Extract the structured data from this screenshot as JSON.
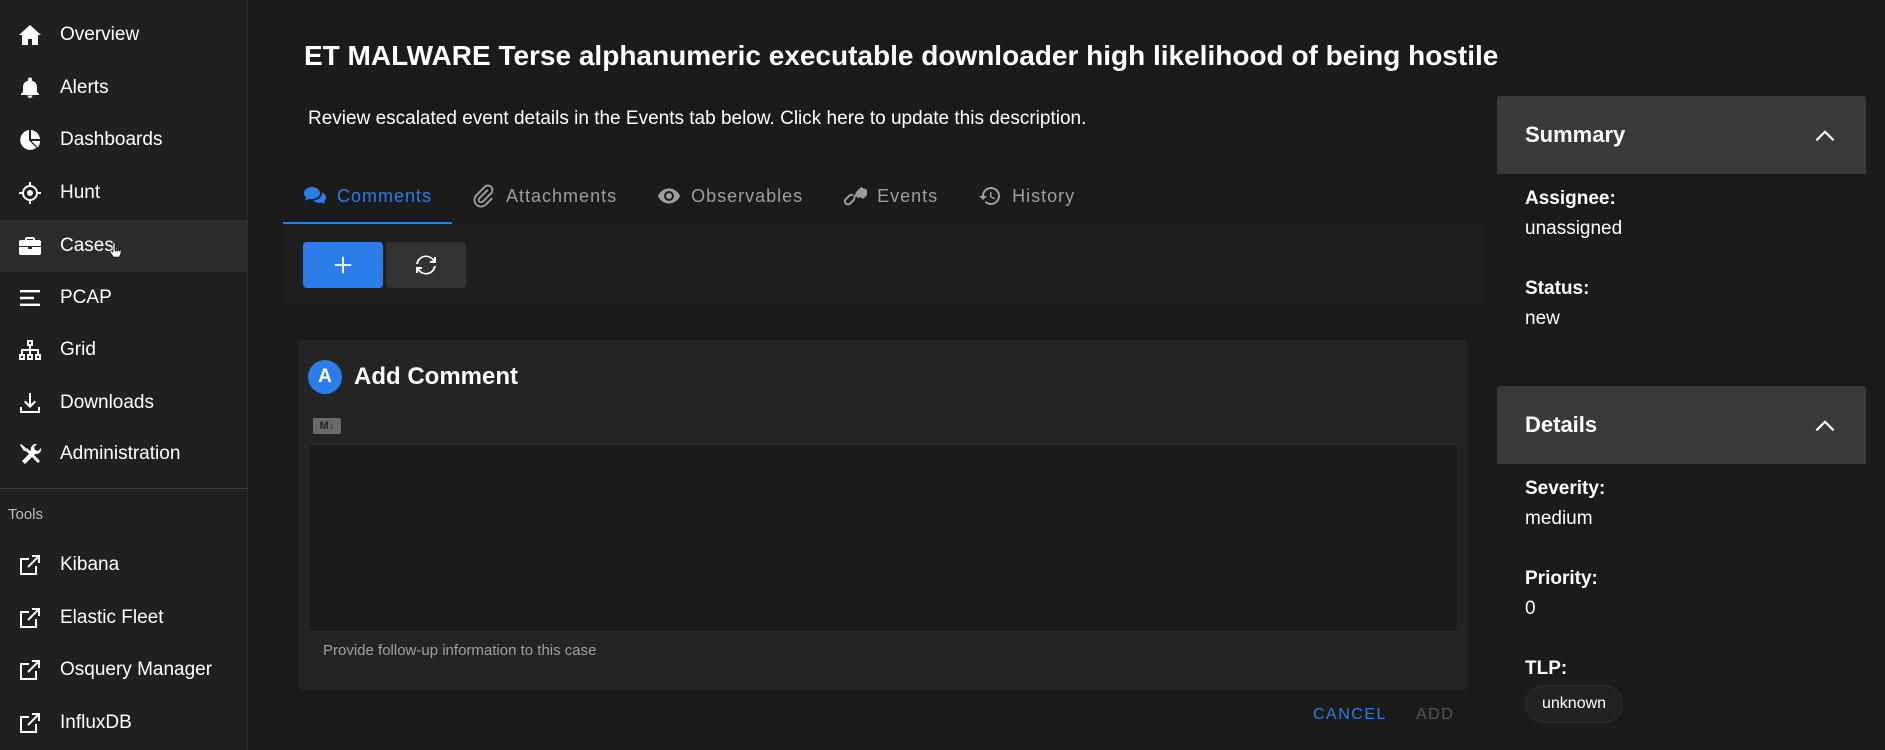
{
  "sidebar": {
    "items": [
      {
        "label": "Overview",
        "icon": "home-icon"
      },
      {
        "label": "Alerts",
        "icon": "bell-icon"
      },
      {
        "label": "Dashboards",
        "icon": "pie-chart-icon"
      },
      {
        "label": "Hunt",
        "icon": "crosshairs-icon"
      },
      {
        "label": "Cases",
        "icon": "briefcase-icon",
        "active": true
      },
      {
        "label": "PCAP",
        "icon": "lines-icon"
      },
      {
        "label": "Grid",
        "icon": "network-icon"
      },
      {
        "label": "Downloads",
        "icon": "download-icon"
      },
      {
        "label": "Administration",
        "icon": "tools-icon"
      }
    ],
    "tools_header": "Tools",
    "tools": [
      {
        "label": "Kibana",
        "icon": "external-link-icon"
      },
      {
        "label": "Elastic Fleet",
        "icon": "external-link-icon"
      },
      {
        "label": "Osquery Manager",
        "icon": "external-link-icon"
      },
      {
        "label": "InfluxDB",
        "icon": "external-link-icon"
      }
    ]
  },
  "case": {
    "title": "ET MALWARE Terse alphanumeric executable downloader high likelihood of being hostile",
    "description": "Review escalated event details in the Events tab below. Click here to update this description."
  },
  "tabs": [
    {
      "label": "Comments",
      "icon": "comments-icon",
      "active": true
    },
    {
      "label": "Attachments",
      "icon": "paperclip-icon"
    },
    {
      "label": "Observables",
      "icon": "eye-icon"
    },
    {
      "label": "Events",
      "icon": "link-icon"
    },
    {
      "label": "History",
      "icon": "history-icon"
    }
  ],
  "comment_form": {
    "avatar_letter": "A",
    "title": "Add Comment",
    "markdown_badge": "M↓",
    "input_value": "",
    "hint": "Provide follow-up information to this case",
    "cancel_label": "CANCEL",
    "add_label": "ADD"
  },
  "summary": {
    "title": "Summary",
    "assignee_label": "Assignee:",
    "assignee_value": "unassigned",
    "status_label": "Status:",
    "status_value": "new"
  },
  "details": {
    "title": "Details",
    "severity_label": "Severity:",
    "severity_value": "medium",
    "priority_label": "Priority:",
    "priority_value": "0",
    "tlp_label": "TLP:",
    "tlp_value": "unknown"
  },
  "colors": {
    "accent": "#2b7de9",
    "background": "#1b1b1b",
    "sidebar": "#202020",
    "panel_header": "#3a3a3a"
  }
}
